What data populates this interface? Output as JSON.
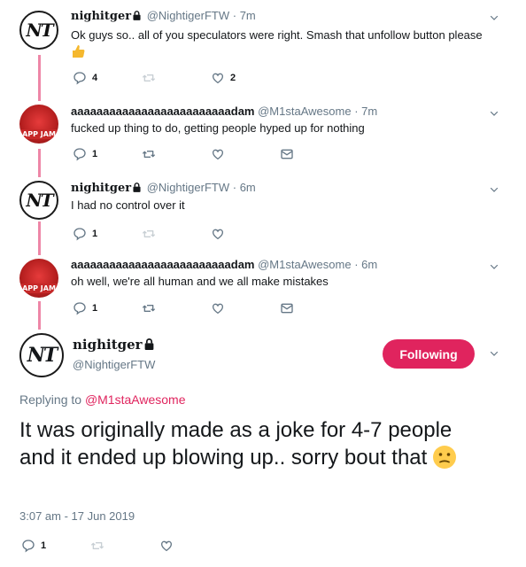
{
  "colors": {
    "accent": "#e0245e",
    "muted": "#657786",
    "text": "#14171a"
  },
  "tweets": [
    {
      "display_name": "nighitger",
      "handle": "@NightigerFTW",
      "time": "7m",
      "text": "Ok guys so.. all of you speculators were right. Smash that unfollow button please",
      "reply_count": "4",
      "like_count": "2",
      "avatar_text": "NT"
    },
    {
      "display_name": "aaaaaaaaaaaaaaaaaaaaaaaaadam",
      "handle": "@M1staAwesome",
      "time": "7m",
      "text": "fucked up thing to do, getting people hyped up for nothing",
      "reply_count": "1",
      "avatar_text": "APP JAM"
    },
    {
      "display_name": "nighitger",
      "handle": "@NightigerFTW",
      "time": "6m",
      "text": "I had no control over it",
      "reply_count": "1",
      "avatar_text": "NT"
    },
    {
      "display_name": "aaaaaaaaaaaaaaaaaaaaaaaaadam",
      "handle": "@M1staAwesome",
      "time": "6m",
      "text": "oh well, we're all human and we all make mistakes",
      "reply_count": "1",
      "avatar_text": "APP JAM"
    }
  ],
  "main": {
    "display_name": "nighitger",
    "handle": "@NightigerFTW",
    "follow_label": "Following",
    "replying_prefix": "Replying to ",
    "replying_to": "@M1staAwesome",
    "text": "It was originally made as a joke for 4-7 people and it ended up blowing up.. sorry bout that",
    "timestamp": "3:07 am - 17 Jun 2019",
    "reply_count": "1",
    "avatar_text": "NT"
  }
}
